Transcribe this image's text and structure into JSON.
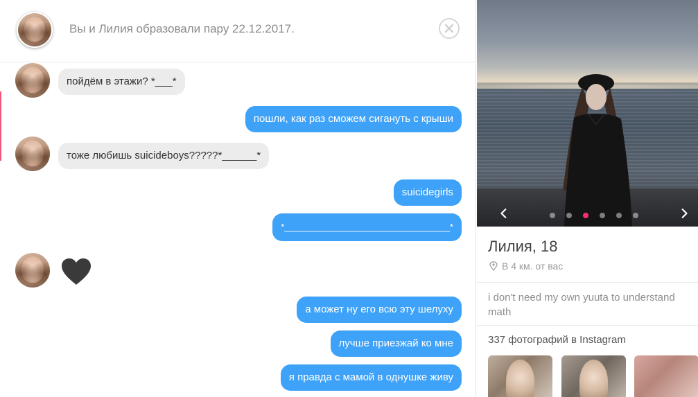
{
  "header": {
    "match_text": "Вы и Лилия образовали пару 22.12.2017."
  },
  "messages": [
    {
      "dir": "in",
      "text": "пойдём в этажи? *___*"
    },
    {
      "dir": "out",
      "text": "пошли, как раз сможем сигануть с крыши"
    },
    {
      "dir": "in",
      "text": "тоже любишь suicideboys?????*______*"
    },
    {
      "dir": "out",
      "text": "suicidegirls"
    },
    {
      "dir": "out",
      "text": "*_________________________________*"
    },
    {
      "dir": "in",
      "text": "",
      "icon": "heart-icon"
    },
    {
      "dir": "out",
      "text": "а может ну его всю эту шелуху"
    },
    {
      "dir": "out",
      "text": "лучше приезжай ко мне"
    },
    {
      "dir": "out",
      "text": "я правда с мамой в однушке живу"
    }
  ],
  "profile": {
    "name_age": "Лилия, 18",
    "distance": "В 4 км. от вас",
    "bio": "i don't need my own yuuta to understand math",
    "instagram_label": "337 фотографий в Instagram",
    "photo_count": 6,
    "active_photo_index": 2
  },
  "colors": {
    "outgoing_bubble": "#3ea2f8",
    "incoming_bubble": "#ececec",
    "active_dot": "#fd2d6c"
  }
}
